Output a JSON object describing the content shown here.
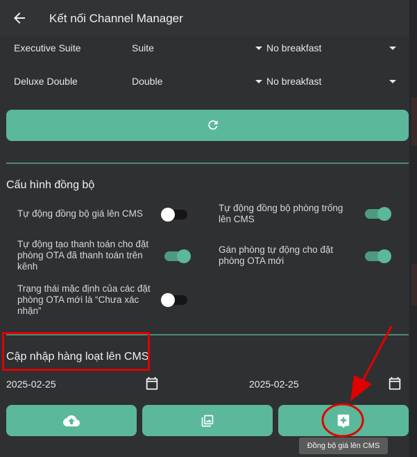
{
  "header": {
    "title": "Kết nối Channel Manager"
  },
  "rooms": [
    {
      "name": "Executive Suite",
      "type": "Suite",
      "breakfast": "No breakfast"
    },
    {
      "name": "Deluxe Double",
      "type": "Double",
      "breakfast": "No breakfast"
    }
  ],
  "sync_config": {
    "title": "Cấu hình đồng bộ",
    "settings": [
      {
        "label": "Tự động đồng bộ giá lên CMS",
        "enabled": false
      },
      {
        "label": "Tự động đồng bộ phòng trống lên CMS",
        "enabled": true
      },
      {
        "label": "Tự động tạo thanh toán cho đặt phòng OTA đã thanh toán trên kênh",
        "enabled": true
      },
      {
        "label": "Gán phòng tự động cho đặt phòng OTA mới",
        "enabled": true
      },
      {
        "label": "Trạng thái mặc định của các đặt phòng OTA mới là “Chưa xác nhận”",
        "enabled": false
      }
    ]
  },
  "bulk_update": {
    "title": "Cập nhập hàng loạt lên CMS",
    "start_date": "2025-02-25",
    "end_date": "2025-02-25",
    "tooltip": "Đồng bộ giá lên CMS"
  },
  "colors": {
    "accent": "#5bb89a",
    "background": "#2f3032",
    "annotation": "#e00000"
  },
  "icons": [
    "arrow-left-icon",
    "caret-down-icon",
    "refresh-icon",
    "cloud-upload-icon",
    "image-stack-icon",
    "sparkle-icon",
    "calendar-icon"
  ]
}
